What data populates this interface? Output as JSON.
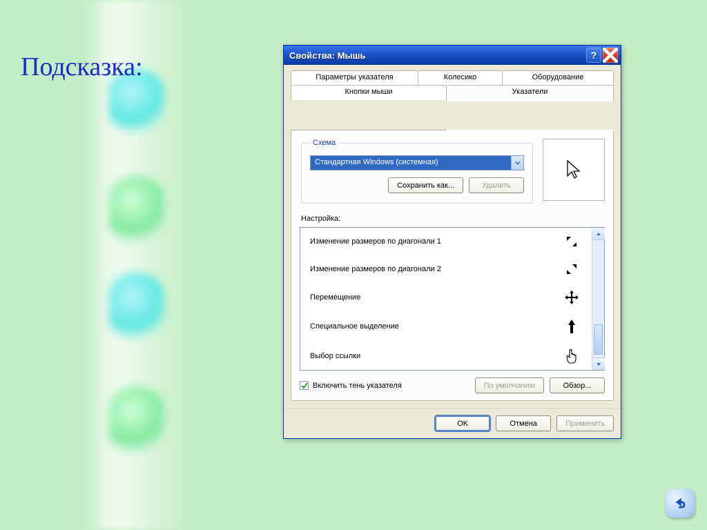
{
  "slide": {
    "hint_heading": "Подсказка:"
  },
  "window": {
    "title": "Свойства: Мышь",
    "tabs": {
      "pointer_options": "Параметры указателя",
      "wheel": "Колесико",
      "hardware": "Оборудование",
      "buttons": "Кнопки мыши",
      "pointers": "Указатели"
    },
    "scheme": {
      "legend": "Схема",
      "selected": "Стандартная Windows (системная)",
      "save_as": "Сохранить как...",
      "delete": "Удалить"
    },
    "custom_label": "Настройка:",
    "list": [
      {
        "label": "Изменение размеров по диагонали 1",
        "icon": "resize-nwse"
      },
      {
        "label": "Изменение размеров по диагонали 2",
        "icon": "resize-nesw"
      },
      {
        "label": "Перемещение",
        "icon": "move"
      },
      {
        "label": "Специальное выделение",
        "icon": "up-arrow"
      },
      {
        "label": "Выбор ссылки",
        "icon": "hand"
      }
    ],
    "shadow_checkbox": "Включить тень указателя",
    "defaults_btn": "По умолчанию",
    "browse_btn": "Обзор...",
    "ok": "OK",
    "cancel": "Отмена",
    "apply": "Применить"
  },
  "colors": {
    "accent": "#316ac5"
  }
}
